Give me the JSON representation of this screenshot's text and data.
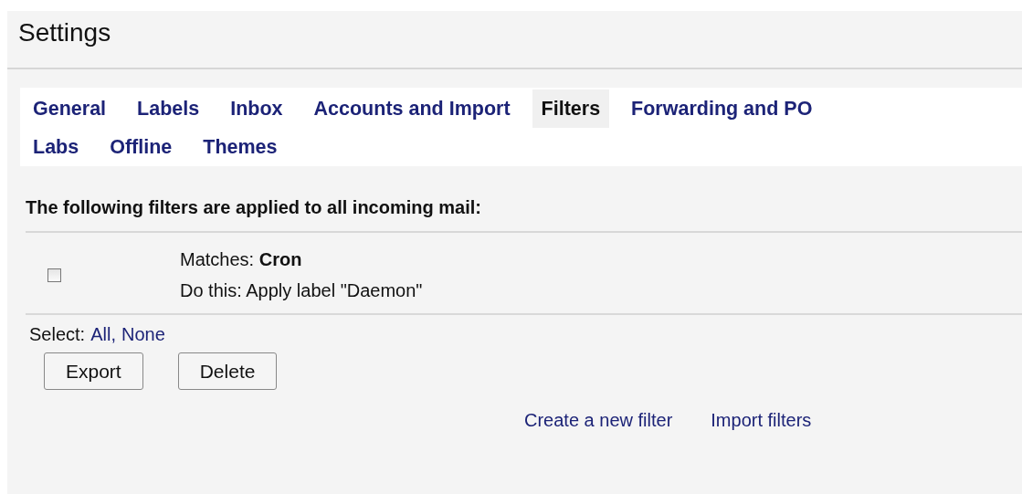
{
  "title": "Settings",
  "tab_rows": [
    [
      {
        "label": "General",
        "selected": false
      },
      {
        "label": "Labels",
        "selected": false
      },
      {
        "label": "Inbox",
        "selected": false
      },
      {
        "label": "Accounts and Import",
        "selected": false
      },
      {
        "label": "Filters",
        "selected": true
      },
      {
        "label": "Forwarding and PO",
        "selected": false
      }
    ],
    [
      {
        "label": "Labs",
        "selected": false
      },
      {
        "label": "Offline",
        "selected": false
      },
      {
        "label": "Themes",
        "selected": false
      }
    ]
  ],
  "heading": "The following filters are applied to all incoming mail:",
  "filters": [
    {
      "checked": false,
      "match_label": "Matches:",
      "match_value": "Cron",
      "action": "Do this: Apply label \"Daemon\""
    }
  ],
  "select": {
    "label": "Select:",
    "links": [
      "All,",
      "None"
    ]
  },
  "buttons": [
    "Export",
    "Delete"
  ],
  "bottom_links": [
    "Create a new filter",
    "Import filters"
  ]
}
